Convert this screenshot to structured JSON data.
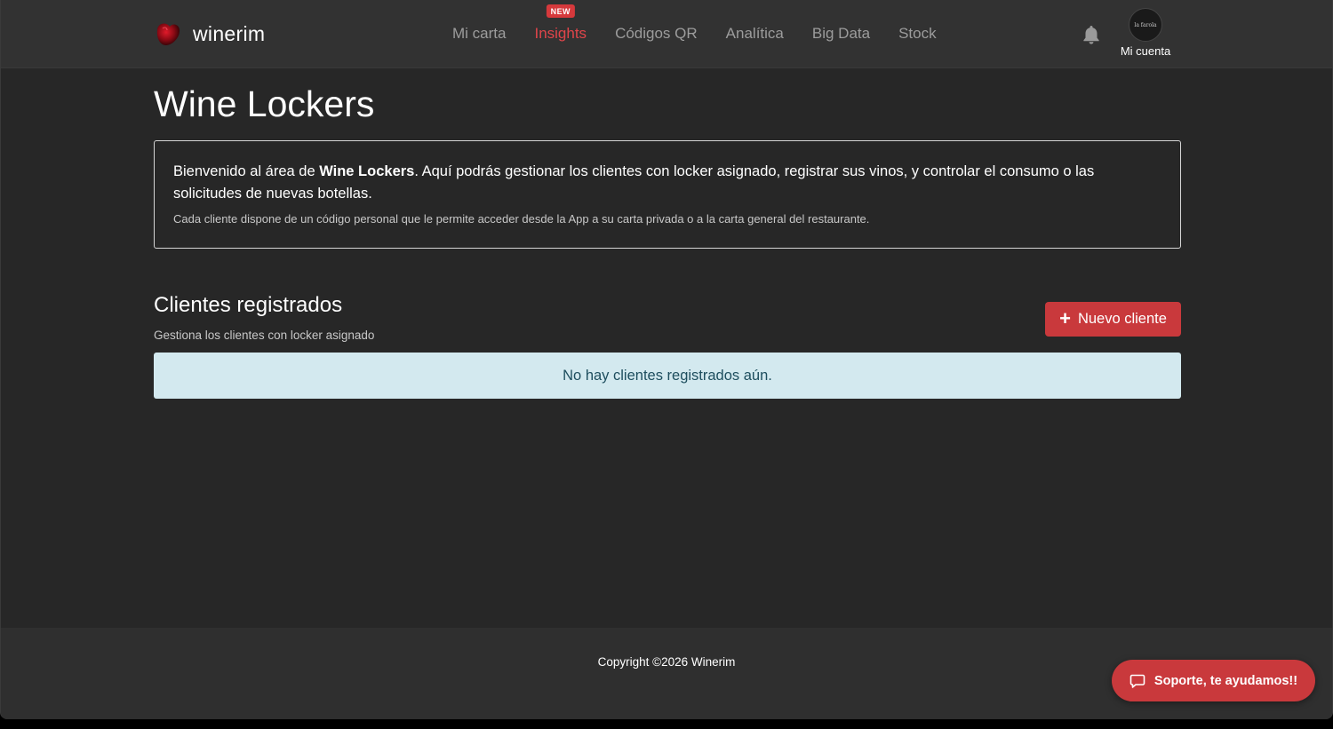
{
  "navbar": {
    "brand": "winerim",
    "items": [
      {
        "label": "Mi carta",
        "active": false
      },
      {
        "label": "Insights",
        "active": true,
        "badge": "NEW"
      },
      {
        "label": "Códigos QR",
        "active": false
      },
      {
        "label": "Analítica",
        "active": false
      },
      {
        "label": "Big Data",
        "active": false
      },
      {
        "label": "Stock",
        "active": false
      }
    ],
    "account_label": "Mi cuenta",
    "avatar_text": "la farola"
  },
  "page": {
    "title": "Wine Lockers",
    "info": {
      "intro_prefix": "Bienvenido al área de ",
      "intro_bold": "Wine Lockers",
      "intro_suffix": ". Aquí podrás gestionar los clientes con locker asignado, registrar sus vinos, y controlar el consumo o las solicitudes de nuevas botellas.",
      "note": "Cada cliente dispone de un código personal que le permite acceder desde la App a su carta privada o a la carta general del restaurante."
    },
    "clients": {
      "title": "Clientes registrados",
      "subtitle": "Gestiona los clientes con locker asignado",
      "new_button": "Nuevo cliente",
      "empty_message": "No hay clientes registrados aún."
    }
  },
  "footer": {
    "copyright": "Copyright ©2026 Winerim",
    "support_button": "Soporte, te ayudamos!!"
  },
  "colors": {
    "accent": "#c9393c",
    "active_nav": "#e0454a",
    "background": "#272727",
    "navbar": "#323232",
    "alert_bg": "#d3e9ef"
  }
}
